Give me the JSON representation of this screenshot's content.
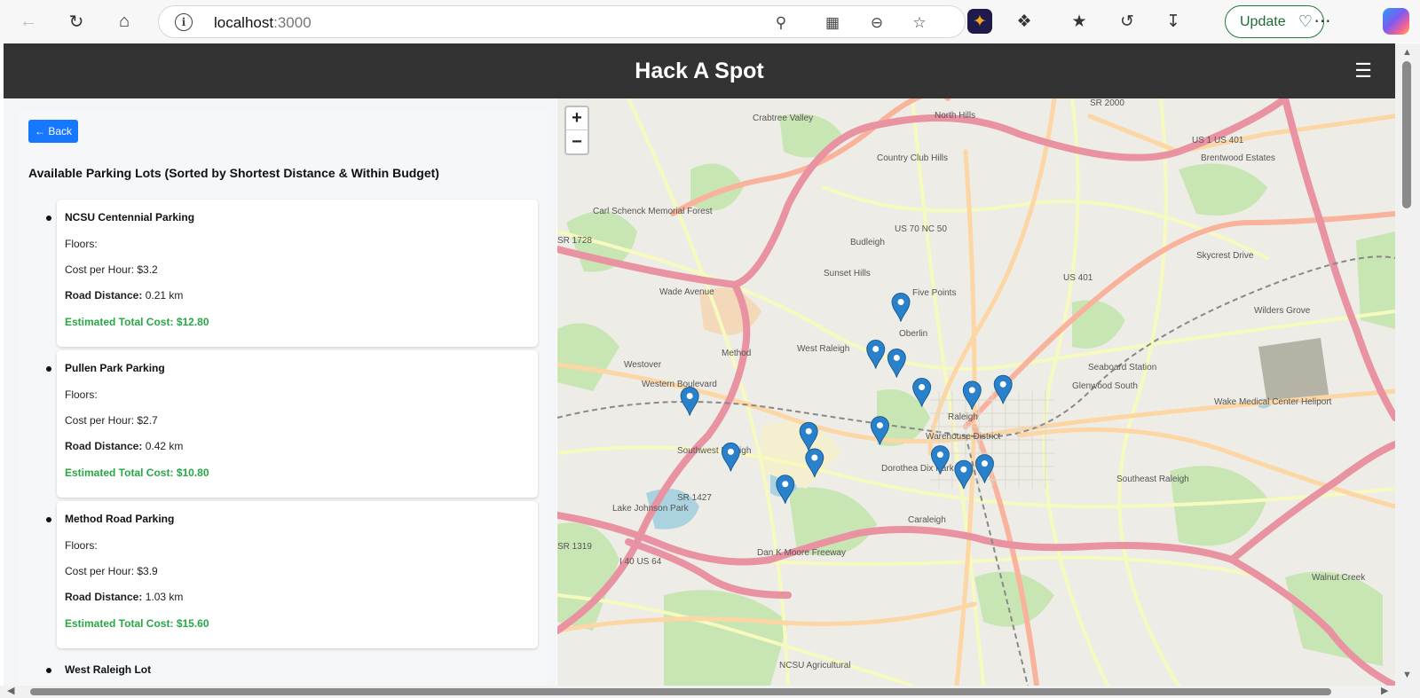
{
  "browser": {
    "url_host": "localhost",
    "url_port": ":3000",
    "update_label": "Update"
  },
  "header": {
    "title": "Hack A Spot",
    "menu_glyph": "☰"
  },
  "panel": {
    "back_label": "← Back",
    "heading": "Available Parking Lots (Sorted by Shortest Distance & Within Budget)",
    "floors_label": "Floors:",
    "cost_label": "Cost per Hour:",
    "distance_label": "Road Distance:",
    "total_label": "Estimated Total Cost:",
    "lots": [
      {
        "name": "NCSU Centennial Parking",
        "floors": "",
        "cost": "$3.2",
        "distance": "0.21 km",
        "total": "$12.80"
      },
      {
        "name": "Pullen Park Parking",
        "floors": "",
        "cost": "$2.7",
        "distance": "0.42 km",
        "total": "$10.80"
      },
      {
        "name": "Method Road Parking",
        "floors": "",
        "cost": "$3.9",
        "distance": "1.03 km",
        "total": "$15.60"
      },
      {
        "name": "West Raleigh Lot"
      }
    ]
  },
  "map": {
    "zoom_in": "+",
    "zoom_out": "−",
    "labels": [
      {
        "text": "Crabtree Valley"
      },
      {
        "text": "North Hills"
      },
      {
        "text": "Country Club Hills"
      },
      {
        "text": "Five Points"
      },
      {
        "text": "Oberlin"
      },
      {
        "text": "West Raleigh"
      },
      {
        "text": "Method"
      },
      {
        "text": "Westover"
      },
      {
        "text": "Seaboard Station"
      },
      {
        "text": "Glenwood South"
      },
      {
        "text": "Raleigh"
      },
      {
        "text": "Warehouse District"
      },
      {
        "text": "Southwest Raleigh"
      },
      {
        "text": "Caraleigh"
      },
      {
        "text": "Southeast Raleigh"
      },
      {
        "text": "Wilders Grove"
      },
      {
        "text": "Walnut Creek"
      },
      {
        "text": "Wake Medical Center Heliport"
      },
      {
        "text": "Lake Johnson Park"
      },
      {
        "text": "Dorothea Dix Park"
      },
      {
        "text": "Carl Schenck Memorial Forest"
      },
      {
        "text": "Brentwood Estates"
      },
      {
        "text": "NCSU Agricultural"
      },
      {
        "text": "Sunset Hills"
      },
      {
        "text": "Budleigh"
      },
      {
        "text": "US 70 NC 50"
      },
      {
        "text": "US 401"
      },
      {
        "text": "US 1 US 401"
      },
      {
        "text": "I 40 US 64"
      },
      {
        "text": "SR 1427"
      },
      {
        "text": "SR 1728"
      },
      {
        "text": "SR 2000"
      },
      {
        "text": "SR 1319"
      },
      {
        "text": "Dan K Moore Freeway"
      },
      {
        "text": "Wade Avenue"
      },
      {
        "text": "Western Boulevard"
      },
      {
        "text": "Skycrest Drive"
      }
    ],
    "markers": [
      {
        "id": "m1",
        "lon_fraction": 0.41,
        "lat_fraction": 0.38
      },
      {
        "id": "m2",
        "lon_fraction": 0.38,
        "lat_fraction": 0.46
      },
      {
        "id": "m3",
        "lon_fraction": 0.405,
        "lat_fraction": 0.475
      },
      {
        "id": "m4",
        "lon_fraction": 0.435,
        "lat_fraction": 0.525
      },
      {
        "id": "m5",
        "lon_fraction": 0.495,
        "lat_fraction": 0.53
      },
      {
        "id": "m6",
        "lon_fraction": 0.532,
        "lat_fraction": 0.52
      },
      {
        "id": "m7",
        "lon_fraction": 0.158,
        "lat_fraction": 0.54
      },
      {
        "id": "m8",
        "lon_fraction": 0.385,
        "lat_fraction": 0.59
      },
      {
        "id": "m9",
        "lon_fraction": 0.457,
        "lat_fraction": 0.64
      },
      {
        "id": "m10",
        "lon_fraction": 0.3,
        "lat_fraction": 0.6
      },
      {
        "id": "m11",
        "lon_fraction": 0.207,
        "lat_fraction": 0.635
      },
      {
        "id": "m12",
        "lon_fraction": 0.307,
        "lat_fraction": 0.645
      },
      {
        "id": "m13",
        "lon_fraction": 0.272,
        "lat_fraction": 0.69
      },
      {
        "id": "m14",
        "lon_fraction": 0.51,
        "lat_fraction": 0.655
      },
      {
        "id": "m15",
        "lon_fraction": 0.485,
        "lat_fraction": 0.665
      }
    ],
    "colors": {
      "water": "#aad3df",
      "park": "#c8e6b4",
      "motorway": "#e892a2",
      "trunk": "#f9b29c",
      "primary": "#fcd6a4",
      "secondary": "#f7fabf",
      "marker": "#2a81cb"
    }
  }
}
